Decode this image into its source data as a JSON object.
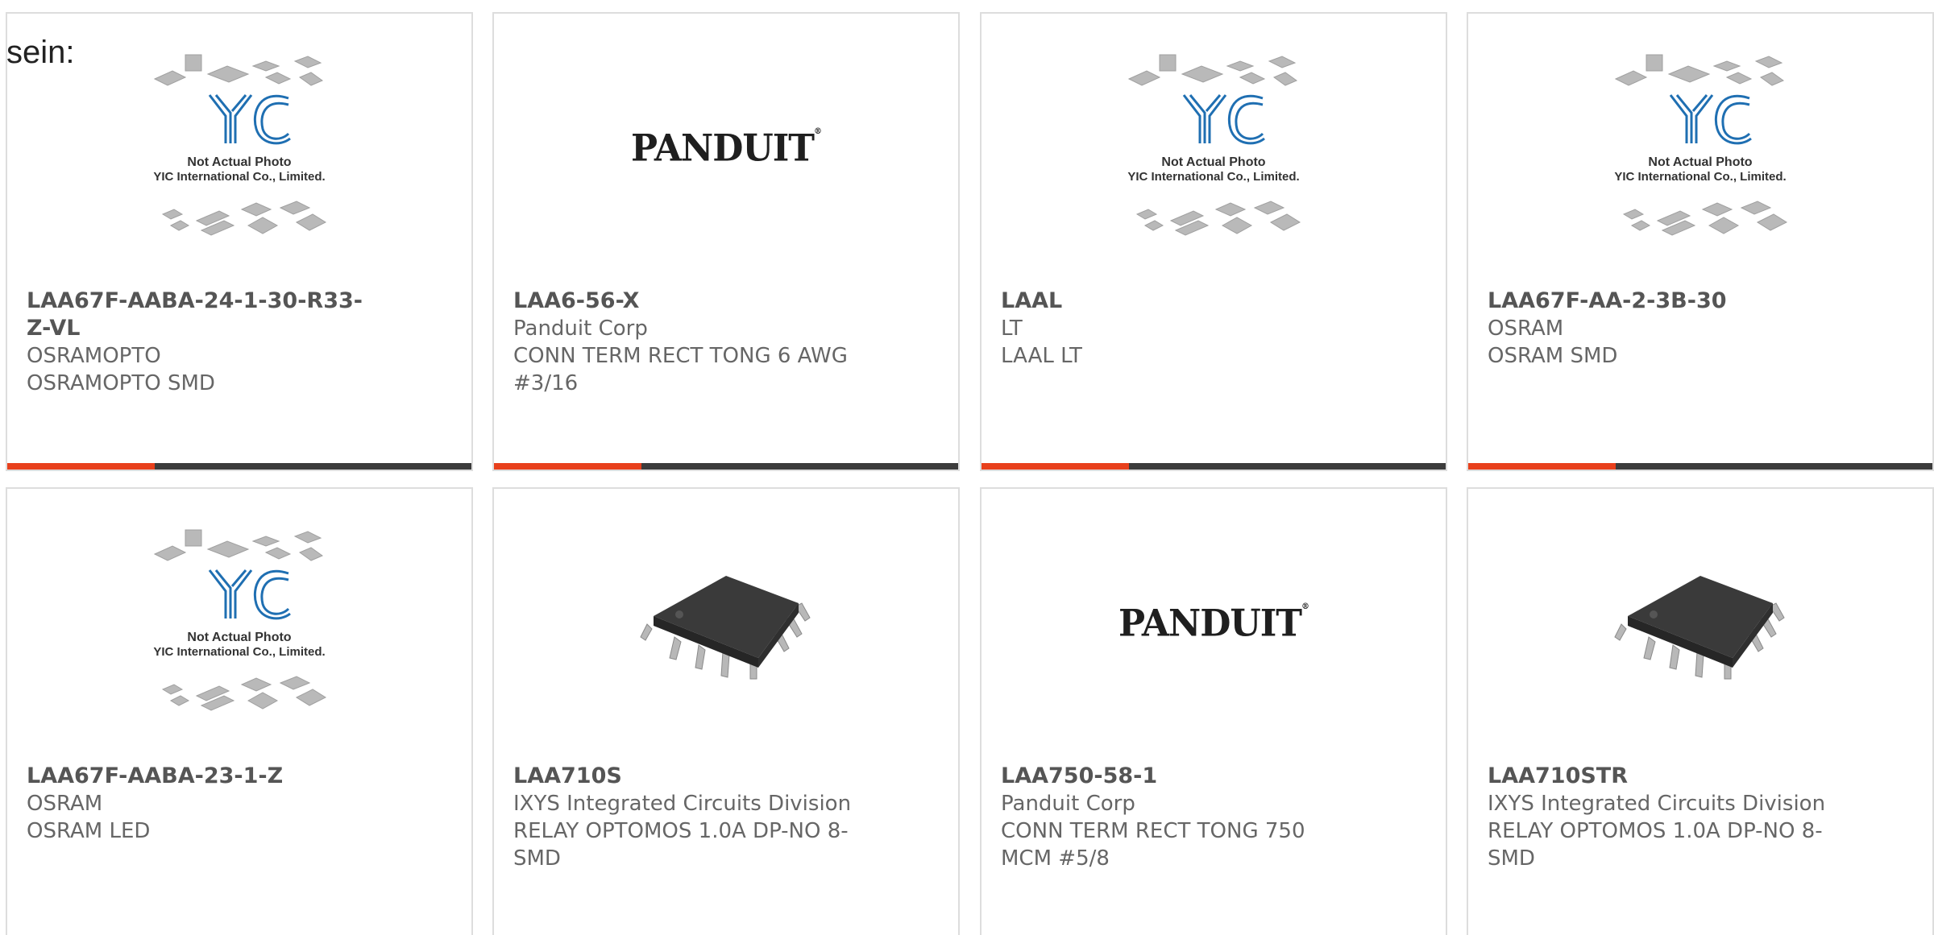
{
  "fragment_text": "sein:",
  "colors": {
    "accent": "#e8401c",
    "bar": "#3c3c3c",
    "card_border": "#dddddd",
    "yic_blue": "#1f6fb2"
  },
  "placeholder": {
    "line1": "Not Actual Photo",
    "line2": "YIC International Co., Limited."
  },
  "panduit_logo_text": "PANDUIT",
  "products": [
    {
      "part": "LAA67F-AABA-24-1-30-R33-Z-VL",
      "maker": "OSRAMOPTO",
      "desc": "OSRAMOPTO SMD",
      "image": "yic-placeholder"
    },
    {
      "part": "LAA6-56-X",
      "maker": "Panduit Corp",
      "desc": "CONN TERM RECT TONG 6 AWG #3/16",
      "image": "panduit-logo"
    },
    {
      "part": "LAAL",
      "maker": "LT",
      "desc": "LAAL LT",
      "image": "yic-placeholder"
    },
    {
      "part": "LAA67F-AA-2-3B-30",
      "maker": "OSRAM",
      "desc": "OSRAM SMD",
      "image": "yic-placeholder"
    },
    {
      "part": "LAA67F-AABA-23-1-Z",
      "maker": "OSRAM",
      "desc": "OSRAM LED",
      "image": "yic-placeholder"
    },
    {
      "part": "LAA710S",
      "maker": "IXYS Integrated Circuits Division",
      "desc": "RELAY OPTOMOS 1.0A DP-NO 8-SMD",
      "image": "ic-chip"
    },
    {
      "part": "LAA750-58-1",
      "maker": "Panduit Corp",
      "desc": "CONN TERM RECT TONG 750 MCM #5/8",
      "image": "panduit-logo"
    },
    {
      "part": "LAA710STR",
      "maker": "IXYS Integrated Circuits Division",
      "desc": "RELAY OPTOMOS 1.0A DP-NO 8-SMD",
      "image": "ic-chip"
    }
  ]
}
